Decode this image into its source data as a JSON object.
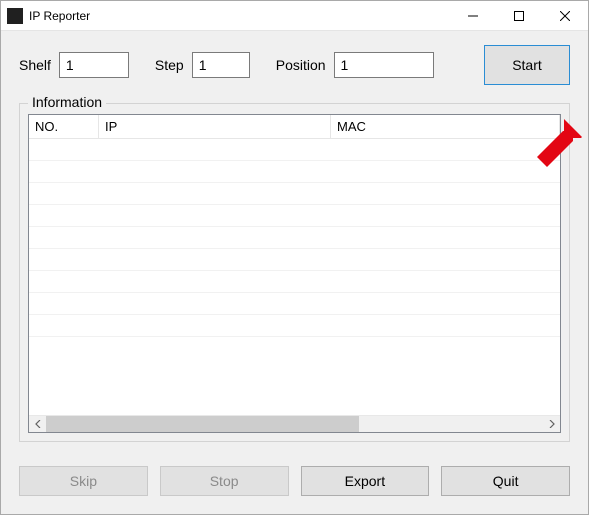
{
  "titlebar": {
    "app_title": "IP Reporter"
  },
  "inputs": {
    "shelf_label": "Shelf",
    "shelf_value": "1",
    "step_label": "Step",
    "step_value": "1",
    "position_label": "Position",
    "position_value": "1"
  },
  "buttons": {
    "start": "Start",
    "skip": "Skip",
    "stop": "Stop",
    "export": "Export",
    "quit": "Quit"
  },
  "group": {
    "title": "Information",
    "col_no": "NO.",
    "col_ip": "IP",
    "col_mac": "MAC"
  }
}
